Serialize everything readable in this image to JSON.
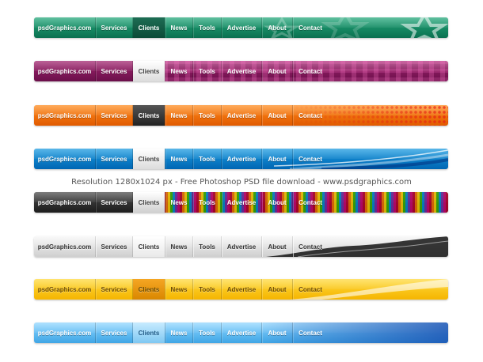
{
  "nav": {
    "brand": "psdGraphics.com",
    "items": [
      "Services",
      "Clients",
      "News",
      "Tools",
      "Advertise",
      "About",
      "Contact"
    ]
  },
  "rows": [
    {
      "id": "green",
      "accent": "#0f8a62",
      "active": "Clients"
    },
    {
      "id": "magenta",
      "accent": "#86175d",
      "active": "Clients"
    },
    {
      "id": "orange",
      "accent": "#f26f0a",
      "active": "Clients"
    },
    {
      "id": "blue",
      "accent": "#0a7fcc",
      "active": "Clients"
    },
    {
      "id": "dark",
      "accent": "#2e2e2e",
      "active": "Clients"
    },
    {
      "id": "silver",
      "accent": "#dddddd",
      "active": "Clients"
    },
    {
      "id": "yellow",
      "accent": "#f8c514",
      "active": "Clients"
    },
    {
      "id": "lightblue",
      "accent": "#63bdf2",
      "active": "Clients"
    }
  ],
  "caption": "Resolution 1280x1024 px - Free Photoshop PSD file download - www.psdgraphics.com"
}
